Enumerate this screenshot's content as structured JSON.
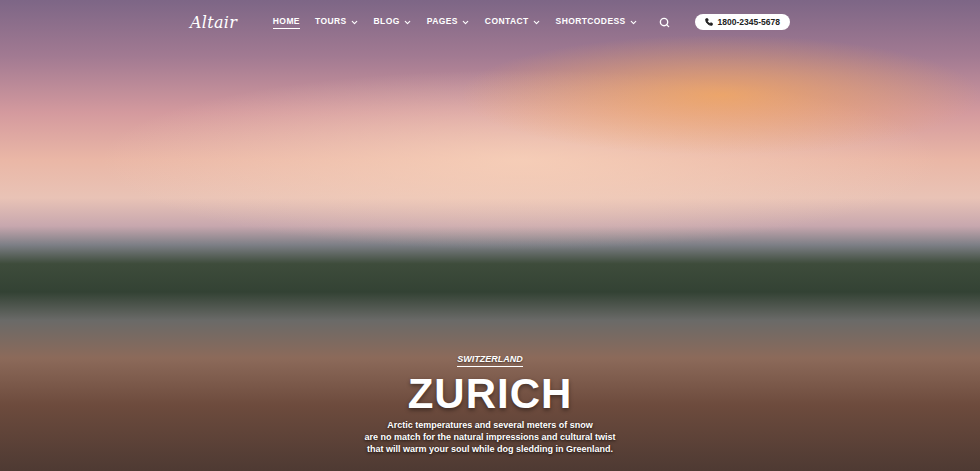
{
  "header": {
    "logo": "Altair",
    "nav": [
      {
        "label": "HOME",
        "selected": true,
        "dropdown": false
      },
      {
        "label": "TOURS",
        "selected": false,
        "dropdown": true
      },
      {
        "label": "BLOG",
        "selected": false,
        "dropdown": true
      },
      {
        "label": "PAGES",
        "selected": false,
        "dropdown": true
      },
      {
        "label": "CONTACT",
        "selected": false,
        "dropdown": true
      },
      {
        "label": "SHORTCODESS",
        "selected": false,
        "dropdown": true
      }
    ],
    "phone": "1800-2345-5678"
  },
  "hero": {
    "subtitle": "SWITZERLAND",
    "title": "ZURICH",
    "description": [
      "Arctic temperatures and several meters of snow",
      "are no match for the natural impressions and cultural twist",
      "that will warm your soul while dog sledding in Greenland."
    ]
  }
}
